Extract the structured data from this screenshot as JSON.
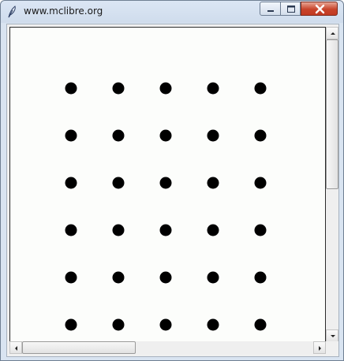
{
  "window": {
    "title": "www.mclibre.org",
    "app_icon": "feather-icon",
    "controls": {
      "minimize_icon": "minimize-icon",
      "maximize_icon": "maximize-icon",
      "close_icon": "close-icon"
    }
  },
  "canvas": {
    "background_color": "#fcfdfb",
    "dot_color": "#000000",
    "dot_grid": {
      "columns": 5,
      "rows": 6
    }
  },
  "scrollbars": {
    "vertical": {
      "up_icon": "arrow-up-icon",
      "down_icon": "arrow-down-icon",
      "position_fraction": 0.0
    },
    "horizontal": {
      "left_icon": "arrow-left-icon",
      "right_icon": "arrow-right-icon",
      "position_fraction": 0.0
    }
  }
}
